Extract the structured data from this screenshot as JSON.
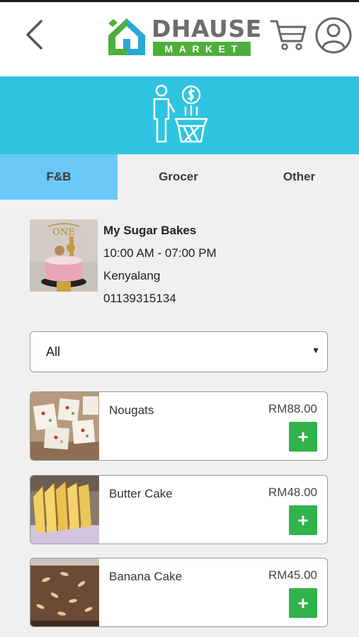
{
  "header": {
    "brand_title": "DHAUSE",
    "brand_subtitle": "MARKET"
  },
  "tabs": [
    {
      "label": "F&B",
      "active": true
    },
    {
      "label": "Grocer",
      "active": false
    },
    {
      "label": "Other",
      "active": false
    }
  ],
  "shop": {
    "name": "My Sugar Bakes",
    "hours": "10:00 AM - 07:00 PM",
    "location": "Kenyalang",
    "phone": "01139315134"
  },
  "filter": {
    "selected": "All"
  },
  "products": [
    {
      "name": "Nougats",
      "price": "RM88.00",
      "add_label": "+"
    },
    {
      "name": "Butter Cake",
      "price": "RM48.00",
      "add_label": "+"
    },
    {
      "name": "Banana Cake",
      "price": "RM45.00",
      "add_label": "+"
    }
  ],
  "colors": {
    "banner": "#2ec4e2",
    "active_tab": "#69c8f8",
    "add_button": "#2fb34a",
    "brand_green": "#4caf3a"
  },
  "icons": {
    "back": "chevron-left-icon",
    "cart": "cart-icon",
    "profile": "user-circle-icon",
    "banner": "shopper-basket-icon",
    "dropdown": "caret-down-icon"
  }
}
